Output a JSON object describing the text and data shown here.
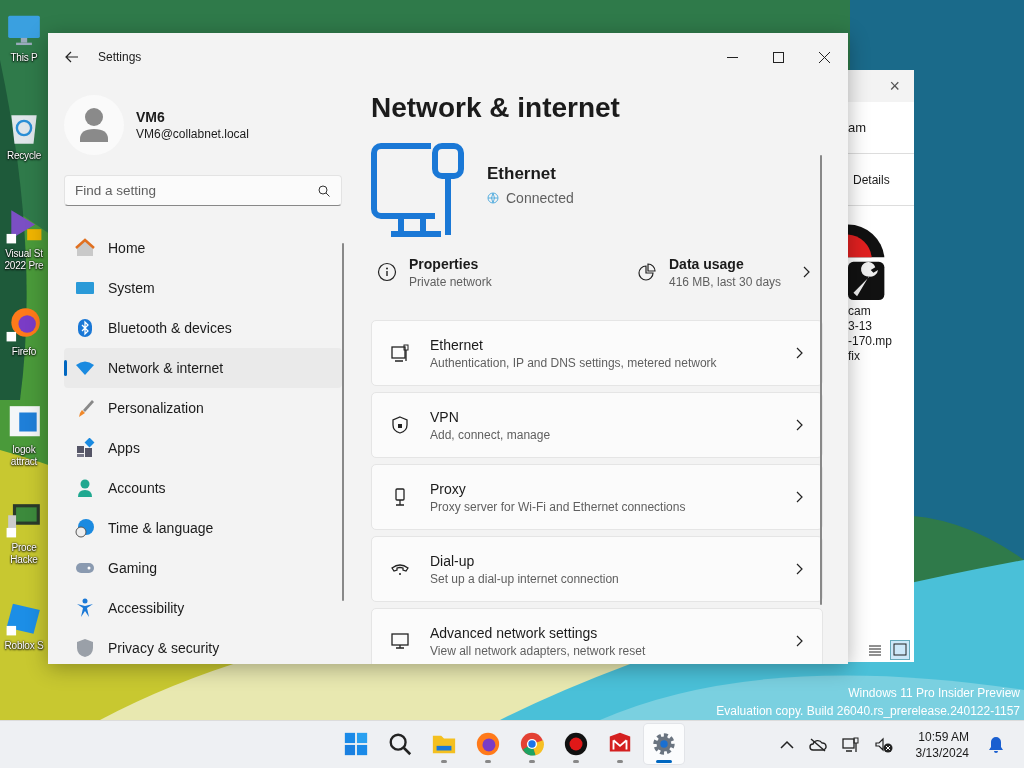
{
  "desktop": {
    "icons": [
      {
        "label": "This P"
      },
      {
        "label": "Recycle"
      },
      {
        "label": "Visual St 2022 Pre"
      },
      {
        "label": "Firefo"
      },
      {
        "label": "logok attract"
      },
      {
        "label": "Proce Hacke"
      },
      {
        "label": "Roblox S"
      }
    ]
  },
  "background_window": {
    "close": "×",
    "header_text": "am",
    "view_label": "Details",
    "file_name_lines": [
      "cam",
      "3-13",
      "-170.mp",
      "fix"
    ]
  },
  "settings_window": {
    "title": "Settings",
    "profile": {
      "name": "VM6",
      "email": "VM6@collabnet.local"
    },
    "search": {
      "placeholder": "Find a setting"
    },
    "nav": [
      {
        "label": "Home",
        "selected": false
      },
      {
        "label": "System",
        "selected": false
      },
      {
        "label": "Bluetooth & devices",
        "selected": false
      },
      {
        "label": "Network & internet",
        "selected": true
      },
      {
        "label": "Personalization",
        "selected": false
      },
      {
        "label": "Apps",
        "selected": false
      },
      {
        "label": "Accounts",
        "selected": false
      },
      {
        "label": "Time & language",
        "selected": false
      },
      {
        "label": "Gaming",
        "selected": false
      },
      {
        "label": "Accessibility",
        "selected": false
      },
      {
        "label": "Privacy & security",
        "selected": false
      }
    ],
    "page_title": "Network & internet",
    "connection": {
      "name": "Ethernet",
      "status": "Connected"
    },
    "summary": [
      {
        "kind": "info",
        "title": "Properties",
        "subtitle": "Private network"
      },
      {
        "kind": "usage",
        "title": "Data usage",
        "subtitle": "416 MB, last 30 days"
      }
    ],
    "cards": [
      {
        "title": "Ethernet",
        "subtitle": "Authentication, IP and DNS settings, metered network"
      },
      {
        "title": "VPN",
        "subtitle": "Add, connect, manage"
      },
      {
        "title": "Proxy",
        "subtitle": "Proxy server for Wi-Fi and Ethernet connections"
      },
      {
        "title": "Dial-up",
        "subtitle": "Set up a dial-up internet connection"
      },
      {
        "title": "Advanced network settings",
        "subtitle": "View all network adapters, network reset"
      }
    ]
  },
  "watermark": [
    "Windows 11 Pro Insider Preview",
    "Evaluation copy. Build 26040.rs_prerelease.240122-1157"
  ],
  "taskbar": {
    "apps": [
      {
        "running": false,
        "selected": false
      },
      {
        "running": false,
        "selected": false
      },
      {
        "running": true,
        "selected": false
      },
      {
        "running": true,
        "selected": false
      },
      {
        "running": true,
        "selected": false
      },
      {
        "running": true,
        "selected": false
      },
      {
        "running": true,
        "selected": false
      },
      {
        "running": true,
        "selected": true
      }
    ],
    "clock": {
      "time": "10:59 AM",
      "date": "3/13/2024"
    }
  }
}
